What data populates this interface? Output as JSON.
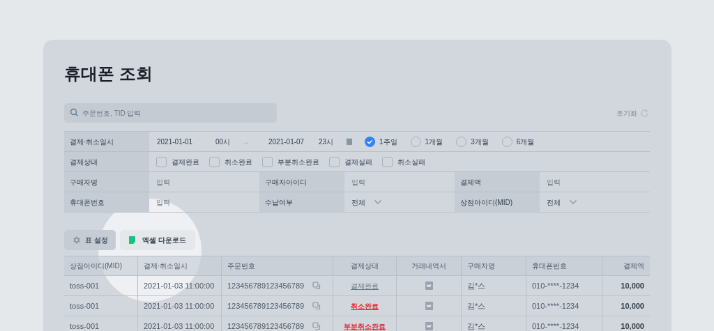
{
  "title": "휴대폰 조회",
  "search": {
    "placeholder": "주문번호, TID 입력"
  },
  "reset": {
    "label": "초기화"
  },
  "filters": {
    "date": {
      "label": "결제·취소일시",
      "from_date": "2021-01-01",
      "from_hour": "00시",
      "arrow": "→",
      "to_date": "2021-01-07",
      "to_hour": "23시",
      "ranges": [
        {
          "label": "1주일",
          "selected": true
        },
        {
          "label": "1개월",
          "selected": false
        },
        {
          "label": "3개월",
          "selected": false
        },
        {
          "label": "6개월",
          "selected": false
        }
      ]
    },
    "status": {
      "label": "결제상태",
      "options": [
        {
          "label": "결제완료",
          "checked": false
        },
        {
          "label": "취소완료",
          "checked": false
        },
        {
          "label": "부분취소완료",
          "checked": false
        },
        {
          "label": "결제실패",
          "checked": false
        },
        {
          "label": "취소실패",
          "checked": false
        }
      ]
    },
    "rows": [
      [
        {
          "label": "구매자명",
          "kind": "input",
          "placeholder": "입력"
        },
        {
          "label": "구매자아이디",
          "kind": "input",
          "placeholder": "입력"
        },
        {
          "label": "결제액",
          "kind": "input",
          "placeholder": "입력"
        }
      ],
      [
        {
          "label": "휴대폰번호",
          "kind": "input",
          "placeholder": "입력"
        },
        {
          "label": "수납여부",
          "kind": "select",
          "value": "전체"
        },
        {
          "label": "상점아이디(MID)",
          "kind": "select",
          "value": "전체"
        }
      ]
    ]
  },
  "toolbar": {
    "settings": "표 설정",
    "excel": "엑셀 다운로드",
    "excel_highlighted": true
  },
  "table": {
    "columns": [
      "상점아이디(MID)",
      "결제·취소일시",
      "주문번호",
      "결제상태",
      "거래내역서",
      "구매자명",
      "휴대폰번호",
      "결제액"
    ],
    "rows": [
      {
        "mid": "toss-001",
        "datetime": "2021-01-03 11:00:00",
        "order": "123456789123456789",
        "status": "결제완료",
        "kind": "complete",
        "buyer": "김*스",
        "phone": "010-****-1234",
        "amount": "10,000"
      },
      {
        "mid": "toss-001",
        "datetime": "2021-01-03 11:00:00",
        "order": "123456789123456789",
        "status": "취소완료",
        "kind": "cancel",
        "buyer": "김*스",
        "phone": "010-****-1234",
        "amount": "10,000"
      },
      {
        "mid": "toss-001",
        "datetime": "2021-01-03 11:00:00",
        "order": "123456789123456789",
        "status": "부분취소완료",
        "kind": "cancel",
        "buyer": "김*스",
        "phone": "010-****-1234",
        "amount": "10,000"
      }
    ]
  }
}
